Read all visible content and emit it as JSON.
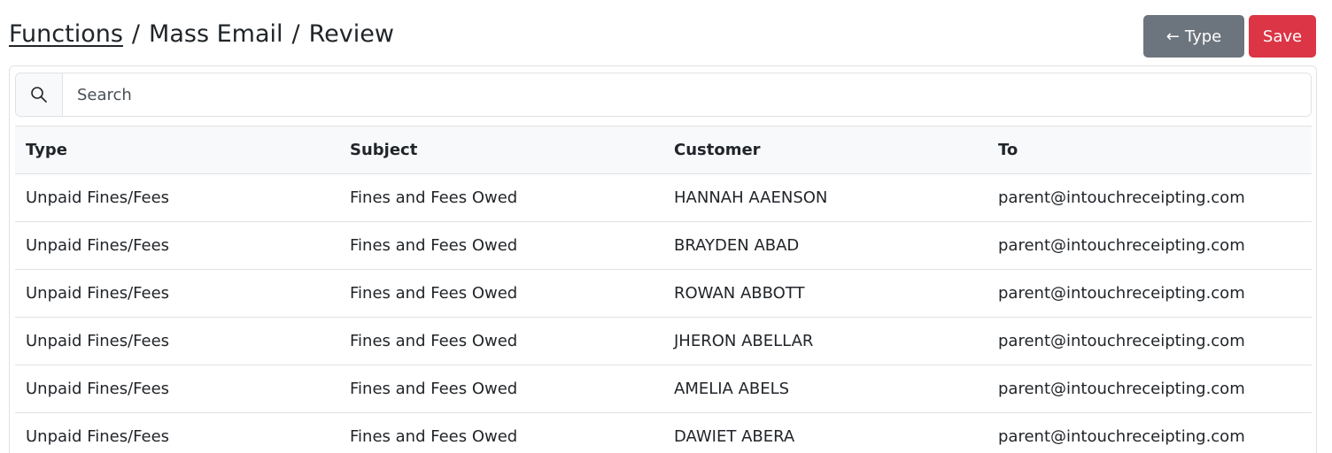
{
  "breadcrumb": {
    "link_label": "Functions",
    "separator": "/",
    "middle_label": "Mass Email",
    "current_label": "Review"
  },
  "actions": {
    "back_arrow": "←",
    "back_label": "Type",
    "save_label": "Save"
  },
  "colors": {
    "secondary": "#6c757d",
    "danger": "#dc3545"
  },
  "search": {
    "icon": "search-icon",
    "placeholder": "Search",
    "value": ""
  },
  "table": {
    "columns": [
      "Type",
      "Subject",
      "Customer",
      "To"
    ],
    "rows": [
      [
        "Unpaid Fines/Fees",
        "Fines and Fees Owed",
        "HANNAH AAENSON",
        "parent@intouchreceipting.com"
      ],
      [
        "Unpaid Fines/Fees",
        "Fines and Fees Owed",
        "BRAYDEN ABAD",
        "parent@intouchreceipting.com"
      ],
      [
        "Unpaid Fines/Fees",
        "Fines and Fees Owed",
        "ROWAN ABBOTT",
        "parent@intouchreceipting.com"
      ],
      [
        "Unpaid Fines/Fees",
        "Fines and Fees Owed",
        "JHERON ABELLAR",
        "parent@intouchreceipting.com"
      ],
      [
        "Unpaid Fines/Fees",
        "Fines and Fees Owed",
        "AMELIA ABELS",
        "parent@intouchreceipting.com"
      ],
      [
        "Unpaid Fines/Fees",
        "Fines and Fees Owed",
        "DAWIET ABERA",
        "parent@intouchreceipting.com"
      ]
    ]
  }
}
